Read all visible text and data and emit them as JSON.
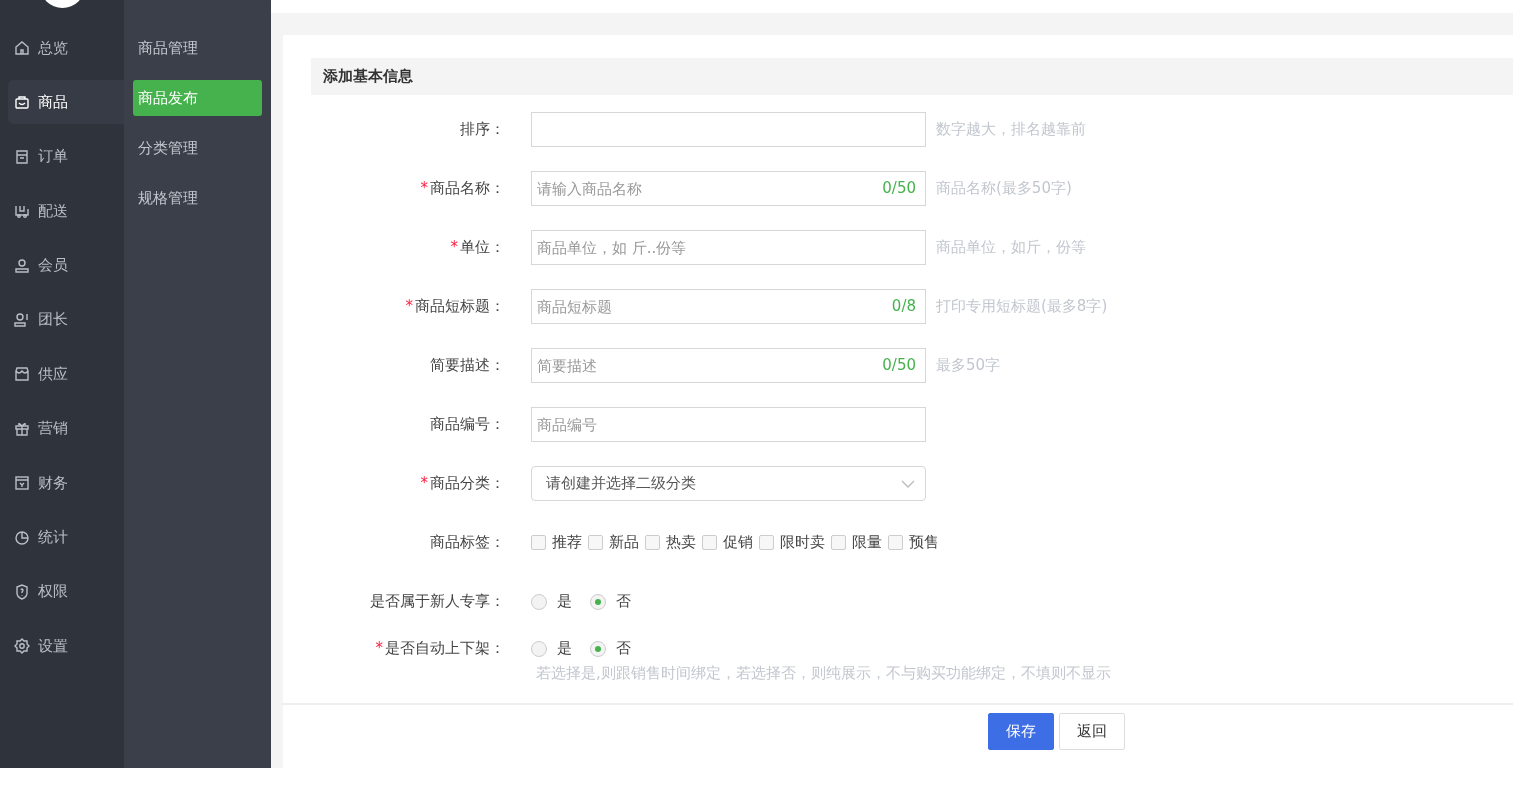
{
  "nav": [
    {
      "label": "总览",
      "selected": false
    },
    {
      "label": "商品",
      "selected": true
    },
    {
      "label": "订单",
      "selected": false
    },
    {
      "label": "配送",
      "selected": false
    },
    {
      "label": "会员",
      "selected": false
    },
    {
      "label": "团长",
      "selected": false
    },
    {
      "label": "供应",
      "selected": false
    },
    {
      "label": "营销",
      "selected": false
    },
    {
      "label": "财务",
      "selected": false
    },
    {
      "label": "统计",
      "selected": false
    },
    {
      "label": "权限",
      "selected": false
    },
    {
      "label": "设置",
      "selected": false
    }
  ],
  "subnav": [
    {
      "label": "商品管理",
      "selected": false
    },
    {
      "label": "商品发布",
      "selected": true
    },
    {
      "label": "分类管理",
      "selected": false
    },
    {
      "label": "规格管理",
      "selected": false
    }
  ],
  "section": {
    "title": "添加基本信息"
  },
  "form": [
    {
      "kind": "text",
      "label": "排序：",
      "hint": "数字越大，排名越靠前"
    },
    {
      "kind": "text",
      "required_mark": "*",
      "label": "商品名称：",
      "placeholder": "请输入商品名称",
      "counter": "0/50",
      "hint": "商品名称(最多50字)"
    },
    {
      "kind": "text",
      "required_mark": "*",
      "label": "单位：",
      "placeholder": "商品单位，如 斤..份等",
      "hint": "商品单位，如斤，份等"
    },
    {
      "kind": "text",
      "required_mark": "*",
      "label": "商品短标题：",
      "placeholder": "商品短标题",
      "counter": "0/8",
      "hint": "打印专用短标题(最多8字)"
    },
    {
      "kind": "text",
      "label": "简要描述：",
      "placeholder": "简要描述",
      "counter": "0/50",
      "hint": "最多50字"
    },
    {
      "kind": "text",
      "label": "商品编号：",
      "placeholder": "商品编号"
    },
    {
      "kind": "select",
      "required_mark": "*",
      "label": "商品分类：",
      "value": "请创建并选择二级分类"
    },
    {
      "kind": "checkboxes",
      "label": "商品标签：",
      "options": [
        {
          "label": "推荐",
          "checked": false
        },
        {
          "label": "新品",
          "checked": false
        },
        {
          "label": "热卖",
          "checked": false
        },
        {
          "label": "促销",
          "checked": false
        },
        {
          "label": "限时卖",
          "checked": false
        },
        {
          "label": "限量",
          "checked": false
        },
        {
          "label": "预售",
          "checked": false
        }
      ]
    },
    {
      "kind": "radio",
      "label": "是否属于新人专享：",
      "options": [
        {
          "label": "是",
          "selected": false
        },
        {
          "label": "否",
          "selected": true
        }
      ]
    },
    {
      "kind": "radio",
      "required_mark": "*",
      "label": "是否自动上下架：",
      "options": [
        {
          "label": "是",
          "selected": false
        },
        {
          "label": "否",
          "selected": true
        }
      ],
      "note": "若选择是,则跟销售时间绑定，若选择否，则纯展示，不与购买功能绑定，不填则不显示"
    }
  ],
  "buttons": [
    {
      "label": "保存",
      "kind": "primary"
    },
    {
      "label": "返回",
      "kind": "default"
    }
  ]
}
